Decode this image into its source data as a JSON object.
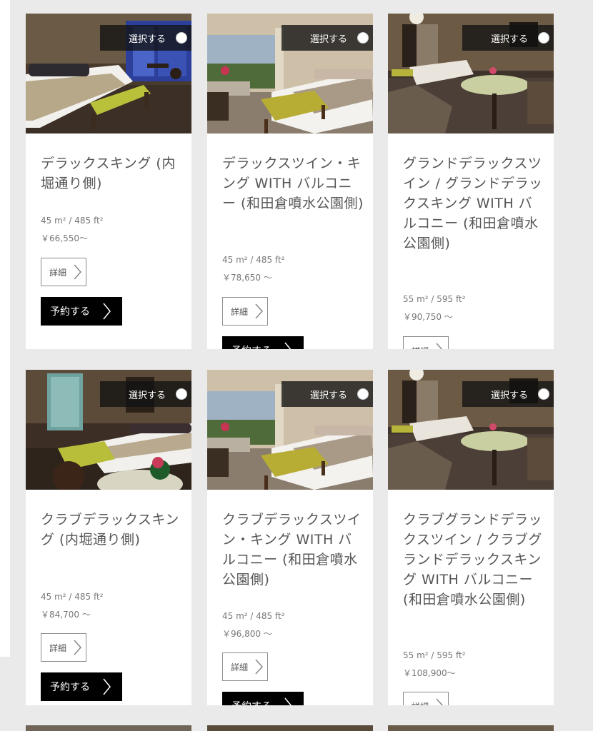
{
  "select_label": "選択する",
  "detail_label": "詳細",
  "book_label": "予約する",
  "rooms": [
    {
      "name": "デラックスキング (内堀通り側)",
      "size": "45 m² / 485 ft²",
      "price": "￥66,550～",
      "photo": "room-photo-king-blue"
    },
    {
      "name": "デラックスツイン・キング WITH バルコニー (和田倉噴水公園側)",
      "size": "45 m² / 485 ft²",
      "price": "￥78,650 ～",
      "photo": "room-photo-balcony"
    },
    {
      "name": "グランドデラックスツイン / グランドデラックスキング WITH バルコニー (和田倉噴水公園側)",
      "size": "55 m² / 595 ft²",
      "price": "￥90,750 ～",
      "photo": "room-photo-grand"
    },
    {
      "name": "クラブデラックスキング (内堀通り側)",
      "size": "45 m² / 485 ft²",
      "price": "￥84,700 ～",
      "photo": "room-photo-club-king"
    },
    {
      "name": "クラブデラックスツイン・キング WITH バルコニー (和田倉噴水公園側)",
      "size": "45 m² / 485 ft²",
      "price": "￥96,800 ～",
      "photo": "room-photo-balcony"
    },
    {
      "name": "クラブグランドデラックスツイン / クラブグランドデラックスキング WITH バルコニー (和田倉噴水公園側)",
      "size": "55 m² / 595 ft²",
      "price": "￥108,900～",
      "photo": "room-photo-grand"
    }
  ]
}
